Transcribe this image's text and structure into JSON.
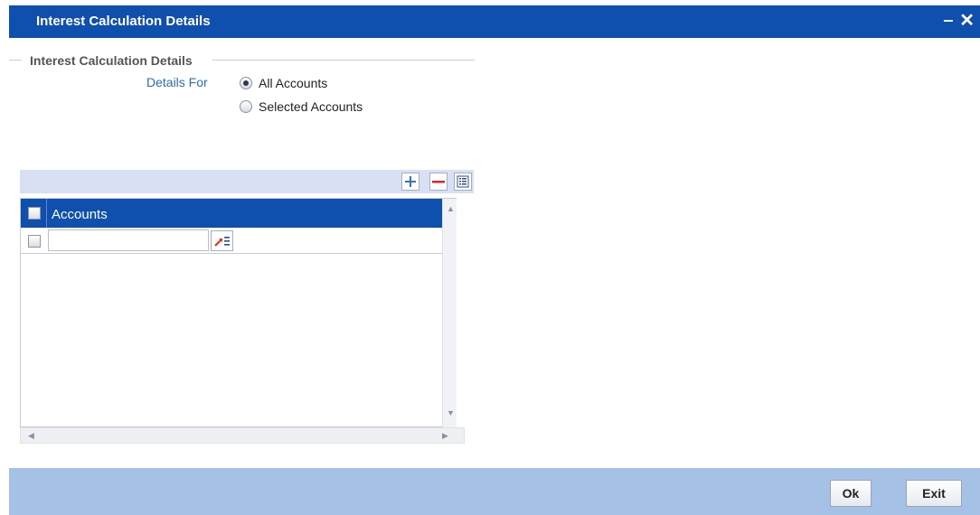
{
  "window": {
    "title": "Interest Calculation Details",
    "minimize_glyph": "‒",
    "close_glyph": "✕"
  },
  "section": {
    "title": "Interest Calculation Details",
    "details_for_label": "Details For",
    "options": [
      {
        "label": "All Accounts",
        "selected": true
      },
      {
        "label": "Selected Accounts",
        "selected": false
      }
    ]
  },
  "grid": {
    "toolbar": {
      "add_icon": "plus-icon",
      "delete_icon": "minus-icon",
      "view_icon": "single-record-view-icon"
    },
    "column_header": "Accounts",
    "rows": [
      {
        "account": "",
        "checked": false
      }
    ],
    "header_checked": false
  },
  "footer": {
    "ok_label": "Ok",
    "exit_label": "Exit"
  },
  "colors": {
    "title_bar": "#0f4fae",
    "footer": "#a6c1e6",
    "label_blue": "#2a6fb0",
    "toolbar_bg": "#d7e1f3"
  }
}
